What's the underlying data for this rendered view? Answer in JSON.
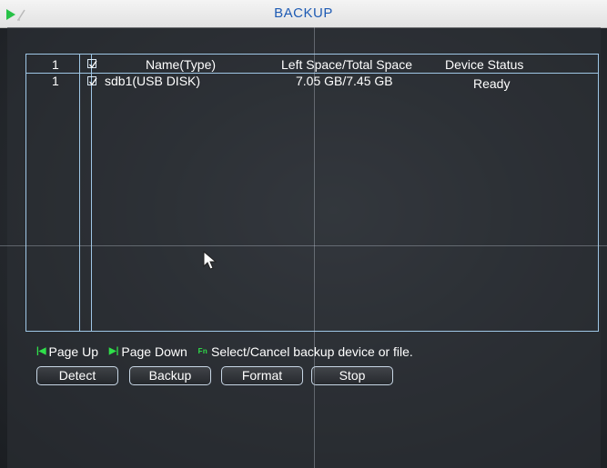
{
  "window": {
    "title": "BACKUP"
  },
  "table": {
    "header": {
      "index": "1",
      "name": "Name(Type)",
      "space": "Left Space/Total Space",
      "status": "Device Status"
    },
    "rows": [
      {
        "index": "1",
        "name": "sdb1(USB DISK)",
        "space": "7.05 GB/7.45 GB",
        "status": "Ready"
      }
    ]
  },
  "help": {
    "page_up": "Page Up",
    "page_down": "Page Down",
    "fn_label": "Fn",
    "select_hint": "Select/Cancel backup device or file."
  },
  "buttons": {
    "detect": "Detect",
    "backup": "Backup",
    "format": "Format",
    "stop": "Stop"
  },
  "colors": {
    "title_text": "#1e5bb4",
    "grid_line": "#9fc7e6",
    "key_icon": "#2fe04a"
  },
  "icons": {
    "title": "play-edit-icon",
    "page_up": "page-up-icon",
    "page_down": "page-down-icon",
    "fn": "fn-key-icon",
    "cursor": "mouse-pointer-icon"
  }
}
